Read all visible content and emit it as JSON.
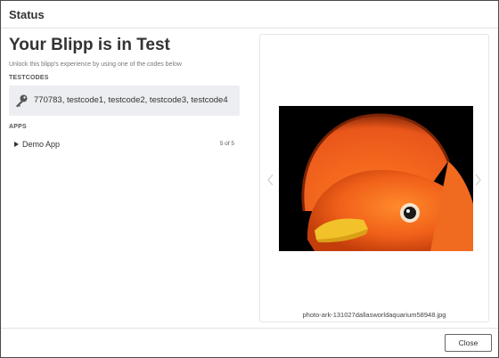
{
  "dialog": {
    "title": "Status"
  },
  "main": {
    "headline": "Your Blipp is in Test",
    "subtitle": "Unlock this blipp's experience by using one of the codes below"
  },
  "testcodes": {
    "label": "TESTCODES",
    "codes": "770783, testcode1, testcode2, testcode3, testcode4",
    "icon": "key-icon"
  },
  "apps": {
    "label": "APPS",
    "items": [
      {
        "name": "Demo App",
        "count": "5 of 5",
        "icon": "caret-right-icon"
      }
    ]
  },
  "preview": {
    "caption": "photo-ark-131027dallasworldaquarium58948.jpg",
    "prev_icon": "chevron-left-icon",
    "next_icon": "chevron-right-icon"
  },
  "footer": {
    "close_label": "Close"
  },
  "colors": {
    "code_box_bg": "#eceef1",
    "bird_orange": "#f0601a",
    "beak_yellow": "#f2c22a"
  }
}
